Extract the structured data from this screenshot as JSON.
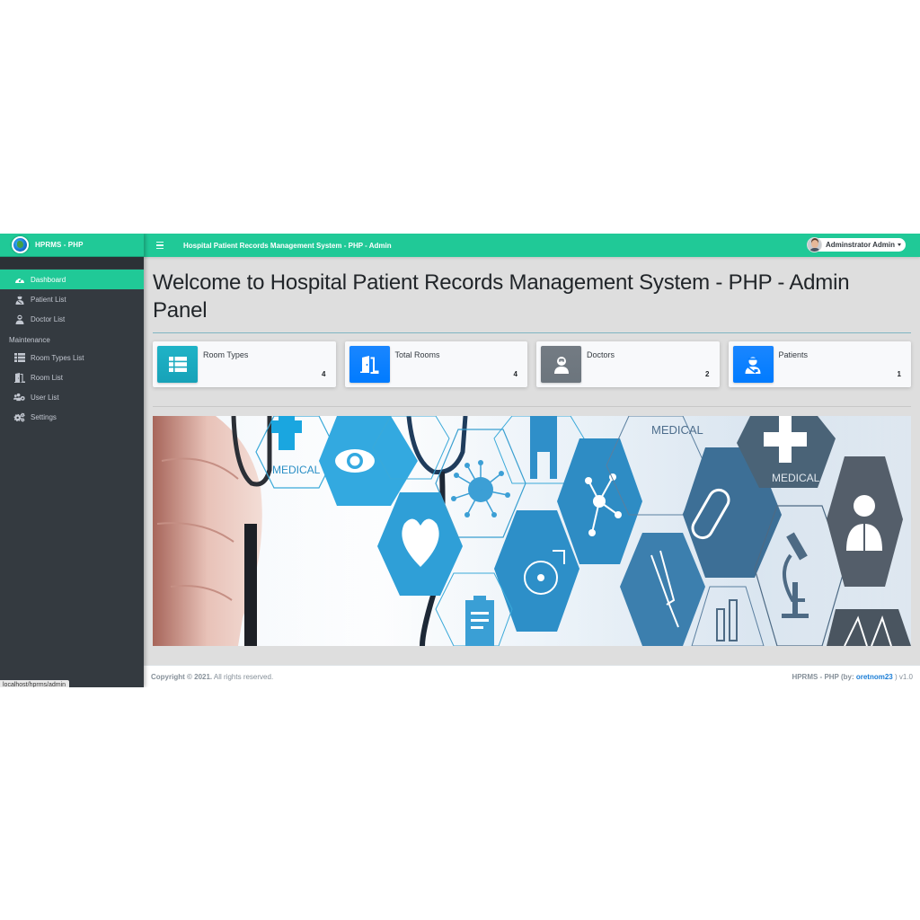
{
  "brand": {
    "name": "HPRMS - PHP",
    "logo_icon": "globe-medical-logo"
  },
  "topbar": {
    "menu_icon": "hamburger-icon",
    "title": "Hospital Patient Records Management System - PHP - Admin",
    "user": {
      "name": "Adminstrator Admin",
      "avatar_icon": "user-avatar",
      "dropdown_icon": "caret-down-icon"
    }
  },
  "sidebar": {
    "items": [
      {
        "label": "Dashboard",
        "icon": "tachometer-icon",
        "active": true
      },
      {
        "label": "Patient List",
        "icon": "user-injured-icon",
        "active": false
      },
      {
        "label": "Doctor List",
        "icon": "user-md-icon",
        "active": false
      }
    ],
    "section_header": "Maintenance",
    "maintenance_items": [
      {
        "label": "Room Types List",
        "icon": "th-list-icon"
      },
      {
        "label": "Room List",
        "icon": "door-open-icon"
      },
      {
        "label": "User List",
        "icon": "users-cog-icon"
      },
      {
        "label": "Settings",
        "icon": "cogs-icon"
      }
    ]
  },
  "main": {
    "title": "Welcome to Hospital Patient Records Management System - PHP - Admin Panel",
    "cards": [
      {
        "label": "Room Types",
        "value": "4",
        "icon": "th-list-icon",
        "color": "#17a2b8"
      },
      {
        "label": "Total Rooms",
        "value": "4",
        "icon": "door-open-icon",
        "color": "#007bff"
      },
      {
        "label": "Doctors",
        "value": "2",
        "icon": "user-md-icon",
        "color": "#6c757d"
      },
      {
        "label": "Patients",
        "value": "1",
        "icon": "user-injured-icon",
        "color": "#007bff"
      }
    ],
    "banner": {
      "description": "Medical banner: hand holding stethoscope with hexagon medical icons",
      "texts": [
        "MEDICAL",
        "MEDICAL",
        "MEDICAL"
      ]
    }
  },
  "footer": {
    "copyright_bold": "Copyright © 2021.",
    "copyright_rest": "All rights reserved.",
    "credit_prefix": "HPRMS - PHP (by: ",
    "credit_author": "oretnom23",
    "credit_suffix": " ) v1.0"
  },
  "status_bar": {
    "url": "localhost/hprms/admin"
  },
  "colors": {
    "accent": "#20c997",
    "sidebar_bg": "#343a40",
    "content_bg": "#dedede",
    "link": "#1c7ed6"
  }
}
